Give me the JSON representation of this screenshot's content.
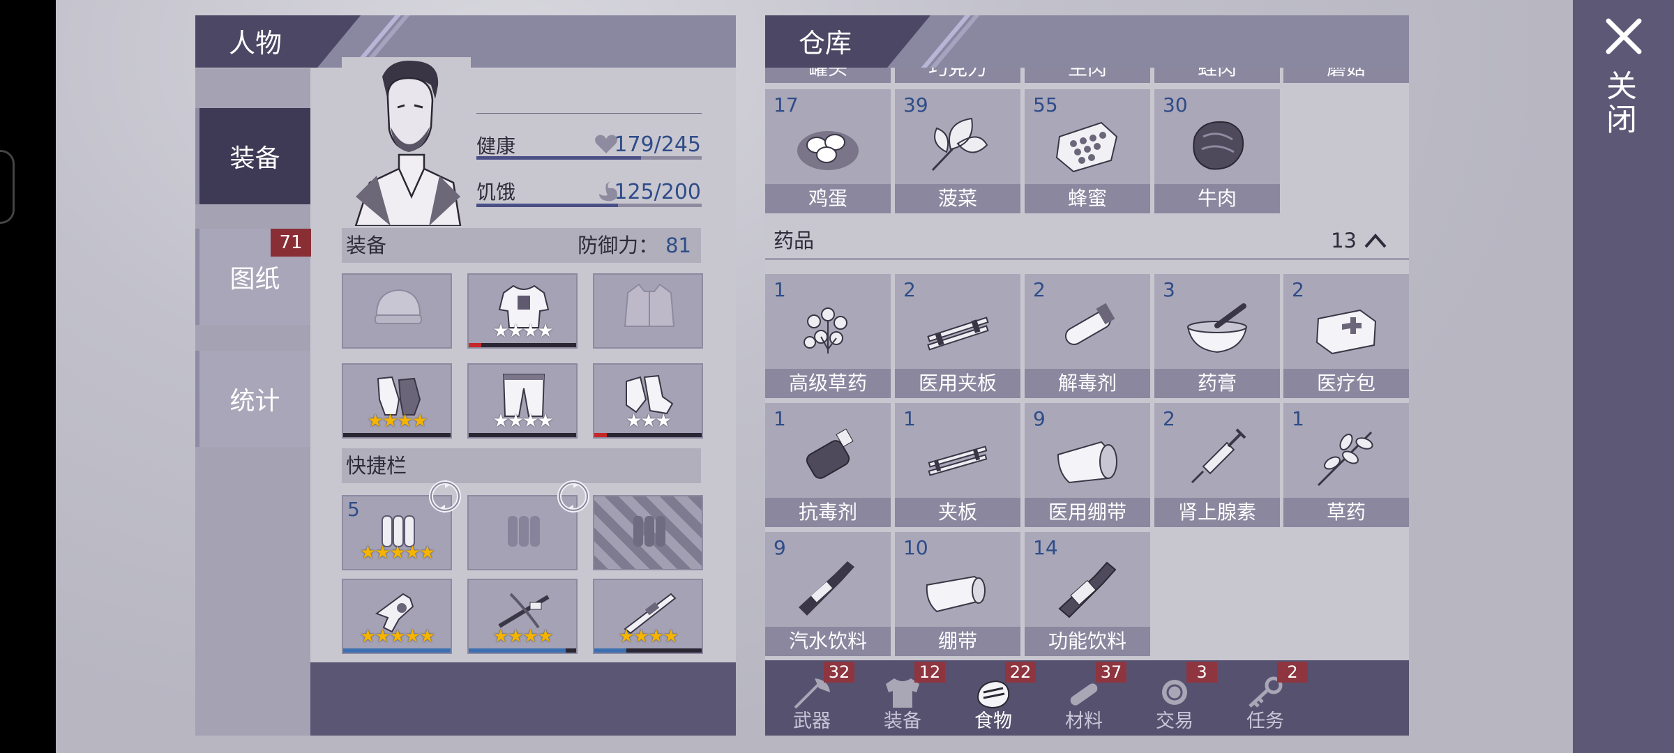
{
  "character_panel": {
    "title": "人物",
    "tabs": [
      {
        "label": "装备",
        "active": true
      },
      {
        "label": "图纸",
        "badge": "71"
      },
      {
        "label": "统计"
      }
    ],
    "stats": {
      "health": {
        "label": "健康",
        "value": "179/245",
        "fraction": 0.73
      },
      "hunger": {
        "label": "饥饿",
        "value": "125/200",
        "fraction": 0.63
      }
    },
    "equipment": {
      "label": "装备",
      "defense_label": "防御力：",
      "defense_value": "81",
      "slots": [
        {
          "icon": "beanie-hat-icon",
          "stars": 0
        },
        {
          "icon": "shirt-icon",
          "stars": 4,
          "durability": 0.12,
          "durability_color": "#c62828"
        },
        {
          "icon": "jacket-icon",
          "stars": 0
        },
        {
          "icon": "gloves-icon",
          "stars": 4,
          "gold": true
        },
        {
          "icon": "pants-icon",
          "stars": 4
        },
        {
          "icon": "boots-icon",
          "stars": 3,
          "durability": 0.12,
          "durability_color": "#c62828"
        }
      ]
    },
    "quickbar": {
      "label": "快捷栏",
      "slots": [
        {
          "icon": "ammo-icon",
          "count": "5",
          "stars": 5,
          "gold": true
        },
        {
          "icon": "ammo-icon",
          "empty": true
        },
        {
          "icon": "ammo-icon",
          "locked": true
        },
        {
          "icon": "revolver-icon",
          "stars": 5,
          "gold": true,
          "durability": 1.0,
          "durability_color": "#3b6fb0"
        },
        {
          "icon": "crossbow-icon",
          "stars": 4,
          "gold": true,
          "durability": 0.9,
          "durability_color": "#3b6fb0"
        },
        {
          "icon": "shotgun-icon",
          "stars": 4,
          "gold": true,
          "durability": 0.3,
          "durability_color": "#3b6fb0"
        }
      ]
    }
  },
  "warehouse": {
    "title": "仓库",
    "cut_row": [
      "罐头",
      "巧克力",
      "生肉",
      "蛙肉",
      "蘑菇"
    ],
    "food_items": [
      {
        "name": "鸡蛋",
        "count": "17",
        "icon": "eggs-icon"
      },
      {
        "name": "菠菜",
        "count": "39",
        "icon": "spinach-icon"
      },
      {
        "name": "蜂蜜",
        "count": "55",
        "icon": "honeycomb-icon"
      },
      {
        "name": "牛肉",
        "count": "30",
        "icon": "beef-icon"
      }
    ],
    "medicine": {
      "label": "药品",
      "count": "13",
      "items": [
        {
          "name": "高级草药",
          "count": "1",
          "icon": "herb-cluster-icon"
        },
        {
          "name": "医用夹板",
          "count": "2",
          "icon": "medical-splint-icon"
        },
        {
          "name": "解毒剂",
          "count": "2",
          "icon": "antidote-vial-icon"
        },
        {
          "name": "药膏",
          "count": "3",
          "icon": "mortar-icon"
        },
        {
          "name": "医疗包",
          "count": "2",
          "icon": "medkit-icon"
        },
        {
          "name": "抗毒剂",
          "count": "1",
          "icon": "antitoxin-bottle-icon"
        },
        {
          "name": "夹板",
          "count": "1",
          "icon": "splint-icon"
        },
        {
          "name": "医用绷带",
          "count": "9",
          "icon": "medical-bandage-icon"
        },
        {
          "name": "肾上腺素",
          "count": "2",
          "icon": "syringe-icon"
        },
        {
          "name": "草药",
          "count": "1",
          "icon": "herb-icon"
        },
        {
          "name": "汽水饮料",
          "count": "9",
          "icon": "soda-bottle-icon"
        },
        {
          "name": "绷带",
          "count": "10",
          "icon": "bandage-roll-icon"
        },
        {
          "name": "功能饮料",
          "count": "14",
          "icon": "energy-drink-icon"
        }
      ]
    },
    "tabs": [
      {
        "label": "武器",
        "badge": "32",
        "icon": "axe-icon",
        "active": false
      },
      {
        "label": "装备",
        "badge": "12",
        "icon": "shirt-icon",
        "active": false
      },
      {
        "label": "食物",
        "badge": "22",
        "icon": "food-icon",
        "active": true
      },
      {
        "label": "材料",
        "badge": "37",
        "icon": "log-icon",
        "active": false
      },
      {
        "label": "交易",
        "badge": "3",
        "icon": "coin-icon",
        "active": false
      },
      {
        "label": "任务",
        "badge": "2",
        "icon": "key-icon",
        "active": false
      }
    ]
  },
  "close_label": "关闭"
}
